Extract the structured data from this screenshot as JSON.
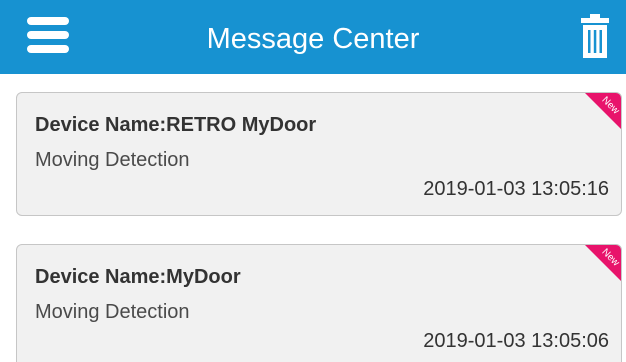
{
  "header": {
    "title": "Message Center",
    "menu_icon": "hamburger-menu-icon",
    "trash_icon": "trash-icon",
    "background_color": "#1792d1"
  },
  "messages": [
    {
      "device_name": "Device Name:RETRO MyDoor",
      "event": "Moving Detection",
      "timestamp": "2019-01-03 13:05:16",
      "badge": "New"
    },
    {
      "device_name": "Device Name:MyDoor",
      "event": "Moving Detection",
      "timestamp": "2019-01-03 13:05:06",
      "badge": "New"
    }
  ],
  "colors": {
    "badge": "#e8136b",
    "card_background": "#f1f1f1"
  }
}
